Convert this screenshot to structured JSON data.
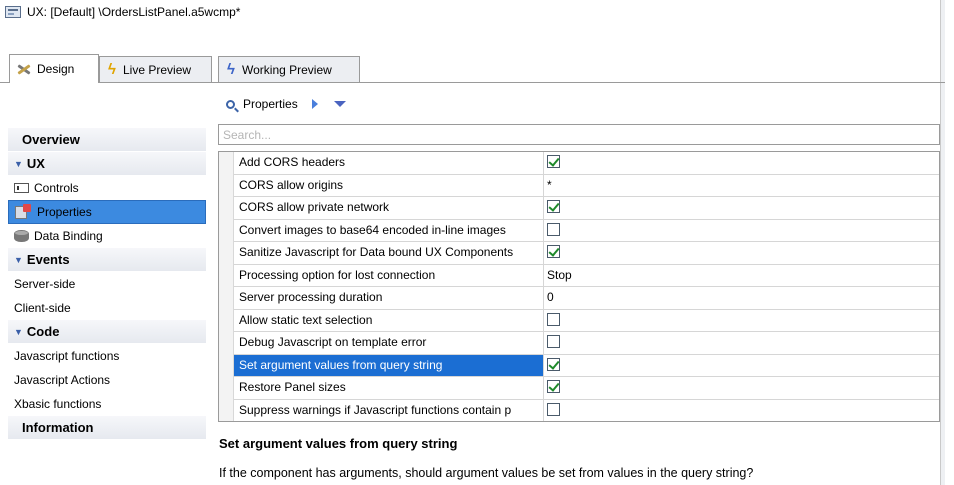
{
  "window": {
    "title": "UX: [Default] \\OrdersListPanel.a5wcmp*"
  },
  "tabs": [
    {
      "label": "Design",
      "icon": "tools-icon",
      "active": true
    },
    {
      "label": "Live Preview",
      "icon": "lightning-icon",
      "active": false
    },
    {
      "label": "Working Preview",
      "icon": "lightning-icon",
      "active": false
    }
  ],
  "toolbar": {
    "label": "Properties"
  },
  "search": {
    "placeholder": "Search..."
  },
  "sidebar": {
    "overview": "Overview",
    "ux_group": "UX",
    "controls": "Controls",
    "properties": "Properties",
    "data_binding": "Data Binding",
    "events_group": "Events",
    "server_side": "Server-side",
    "client_side": "Client-side",
    "code_group": "Code",
    "js_functions": "Javascript functions",
    "js_actions": "Javascript Actions",
    "xbasic_functions": "Xbasic functions",
    "information": "Information"
  },
  "properties": [
    {
      "name": "Add CORS headers",
      "type": "checkbox",
      "checked": true
    },
    {
      "name": "CORS allow origins",
      "type": "text",
      "value": "*"
    },
    {
      "name": "CORS allow private network",
      "type": "checkbox",
      "checked": true
    },
    {
      "name": "Convert images to base64 encoded in-line images",
      "type": "checkbox",
      "checked": false
    },
    {
      "name": "Sanitize Javascript for Data bound UX Components",
      "type": "checkbox",
      "checked": true
    },
    {
      "name": "Processing option for lost connection",
      "type": "text",
      "value": "Stop"
    },
    {
      "name": "Server processing duration",
      "type": "text",
      "value": "0"
    },
    {
      "name": "Allow static text selection",
      "type": "checkbox",
      "checked": false
    },
    {
      "name": "Debug Javascript on template error",
      "type": "checkbox",
      "checked": false
    },
    {
      "name": "Set argument values from query string",
      "type": "checkbox",
      "checked": true,
      "selected": true
    },
    {
      "name": "Restore Panel sizes",
      "type": "checkbox",
      "checked": true
    },
    {
      "name": "Suppress warnings if Javascript functions contain p",
      "type": "checkbox",
      "checked": false
    }
  ],
  "description": {
    "title": "Set argument values from query string",
    "text": "If the component has arguments, should argument values be set from values in the query string?"
  }
}
